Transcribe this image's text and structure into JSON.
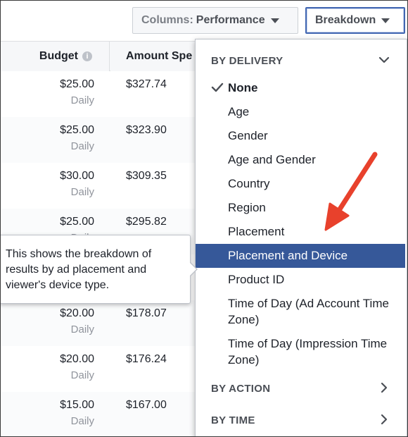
{
  "toolbar": {
    "columns_prefix": "Columns:",
    "columns_value": "Performance",
    "breakdown_label": "Breakdown"
  },
  "table": {
    "headers": {
      "budget": "Budget",
      "amount": "Amount Spe"
    },
    "info_icon_glyph": "i",
    "rows": [
      {
        "budget": "$25.00",
        "period": "Daily",
        "amount": "$327.74"
      },
      {
        "budget": "$25.00",
        "period": "Daily",
        "amount": "$323.90"
      },
      {
        "budget": "$30.00",
        "period": "Daily",
        "amount": "$309.35"
      },
      {
        "budget": "$25.00",
        "period": "Daily",
        "amount": "$295.82"
      },
      {
        "budget": "",
        "period": "",
        "amount": ""
      },
      {
        "budget": "$20.00",
        "period": "Daily",
        "amount": "$178.07"
      },
      {
        "budget": "$20.00",
        "period": "Daily",
        "amount": "$176.24"
      },
      {
        "budget": "$15.00",
        "period": "Daily",
        "amount": "$167.00"
      }
    ]
  },
  "tooltip": {
    "text": "This shows the breakdown of results by ad placement and viewer's device type."
  },
  "dropdown": {
    "by_delivery": {
      "label": "BY DELIVERY",
      "items": [
        "None",
        "Age",
        "Gender",
        "Age and Gender",
        "Country",
        "Region",
        "Placement",
        "Placement and Device",
        "Product ID",
        "Time of Day (Ad Account Time Zone)",
        "Time of Day (Impression Time Zone)"
      ],
      "selected": "None",
      "highlighted": "Placement and Device"
    },
    "by_action": {
      "label": "BY ACTION"
    },
    "by_time": {
      "label": "BY TIME"
    }
  },
  "colors": {
    "accent": "#365899",
    "annotation_arrow": "#e8412c",
    "muted_text": "#90949c"
  },
  "icons": {
    "info": "info-icon",
    "check": "checkmark-icon",
    "collapse": "chevron-down-icon",
    "expand": "chevron-right-icon",
    "dropdown_caret": "caret-down-icon"
  }
}
